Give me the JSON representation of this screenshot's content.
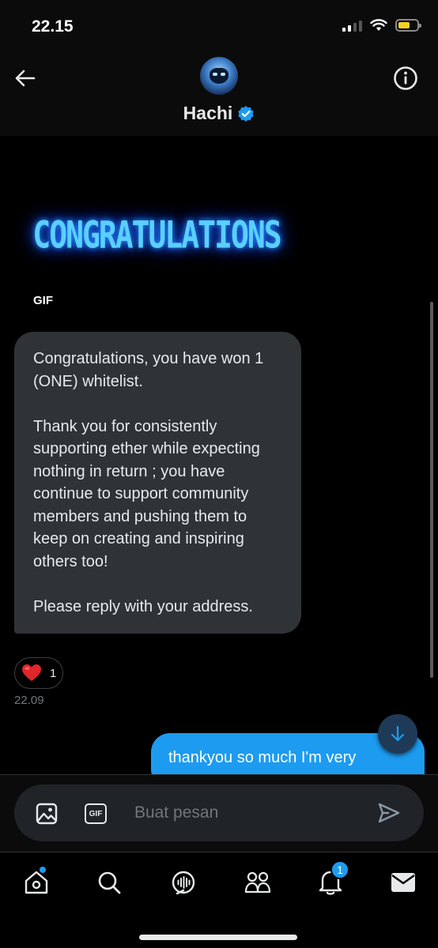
{
  "status_bar": {
    "time": "22.15",
    "battery_level": 0.62
  },
  "header": {
    "name": "Hachi",
    "verified": true,
    "back_icon": "arrow-left-icon",
    "info_icon": "info-circle-icon"
  },
  "conversation": {
    "gif_text": "CONGRATULATIONS",
    "gif_label": "GIF",
    "received_message": "Congratulations, you have won 1 (ONE) whitelist.\n\nThank you for consistently supporting ether while expecting nothing in return ; you have continue to support community members and pushing them to keep on creating and inspiring others too!\n\nPlease reply with your address.",
    "reaction": {
      "emoji": "❤️",
      "count": "1"
    },
    "received_time": "22.09",
    "sent_message": "thankyou so much I'm very"
  },
  "composer": {
    "placeholder": "Buat pesan",
    "gif_button_label": "GIF"
  },
  "bottom_nav": {
    "items": [
      "home-icon",
      "search-icon",
      "spaces-icon",
      "communities-icon",
      "notifications-icon",
      "messages-icon"
    ],
    "notification_count": "1"
  },
  "colors": {
    "accent": "#1d9bf0",
    "bubble_in": "#2f3336",
    "background": "#000000"
  }
}
